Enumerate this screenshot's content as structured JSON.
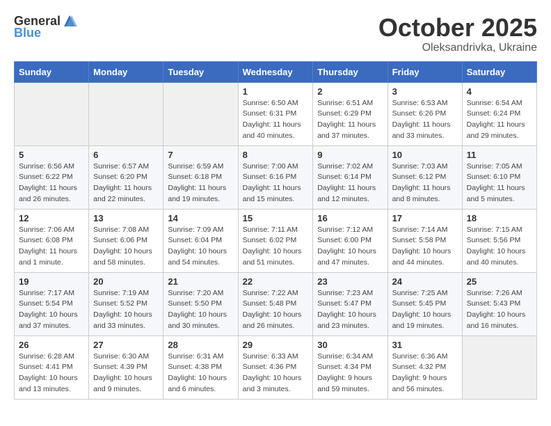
{
  "header": {
    "logo_general": "General",
    "logo_blue": "Blue",
    "title": "October 2025",
    "subtitle": "Oleksandrivka, Ukraine"
  },
  "weekdays": [
    "Sunday",
    "Monday",
    "Tuesday",
    "Wednesday",
    "Thursday",
    "Friday",
    "Saturday"
  ],
  "weeks": [
    [
      {
        "day": "",
        "info": ""
      },
      {
        "day": "",
        "info": ""
      },
      {
        "day": "",
        "info": ""
      },
      {
        "day": "1",
        "info": "Sunrise: 6:50 AM\nSunset: 6:31 PM\nDaylight: 11 hours\nand 40 minutes."
      },
      {
        "day": "2",
        "info": "Sunrise: 6:51 AM\nSunset: 6:29 PM\nDaylight: 11 hours\nand 37 minutes."
      },
      {
        "day": "3",
        "info": "Sunrise: 6:53 AM\nSunset: 6:26 PM\nDaylight: 11 hours\nand 33 minutes."
      },
      {
        "day": "4",
        "info": "Sunrise: 6:54 AM\nSunset: 6:24 PM\nDaylight: 11 hours\nand 29 minutes."
      }
    ],
    [
      {
        "day": "5",
        "info": "Sunrise: 6:56 AM\nSunset: 6:22 PM\nDaylight: 11 hours\nand 26 minutes."
      },
      {
        "day": "6",
        "info": "Sunrise: 6:57 AM\nSunset: 6:20 PM\nDaylight: 11 hours\nand 22 minutes."
      },
      {
        "day": "7",
        "info": "Sunrise: 6:59 AM\nSunset: 6:18 PM\nDaylight: 11 hours\nand 19 minutes."
      },
      {
        "day": "8",
        "info": "Sunrise: 7:00 AM\nSunset: 6:16 PM\nDaylight: 11 hours\nand 15 minutes."
      },
      {
        "day": "9",
        "info": "Sunrise: 7:02 AM\nSunset: 6:14 PM\nDaylight: 11 hours\nand 12 minutes."
      },
      {
        "day": "10",
        "info": "Sunrise: 7:03 AM\nSunset: 6:12 PM\nDaylight: 11 hours\nand 8 minutes."
      },
      {
        "day": "11",
        "info": "Sunrise: 7:05 AM\nSunset: 6:10 PM\nDaylight: 11 hours\nand 5 minutes."
      }
    ],
    [
      {
        "day": "12",
        "info": "Sunrise: 7:06 AM\nSunset: 6:08 PM\nDaylight: 11 hours\nand 1 minute."
      },
      {
        "day": "13",
        "info": "Sunrise: 7:08 AM\nSunset: 6:06 PM\nDaylight: 10 hours\nand 58 minutes."
      },
      {
        "day": "14",
        "info": "Sunrise: 7:09 AM\nSunset: 6:04 PM\nDaylight: 10 hours\nand 54 minutes."
      },
      {
        "day": "15",
        "info": "Sunrise: 7:11 AM\nSunset: 6:02 PM\nDaylight: 10 hours\nand 51 minutes."
      },
      {
        "day": "16",
        "info": "Sunrise: 7:12 AM\nSunset: 6:00 PM\nDaylight: 10 hours\nand 47 minutes."
      },
      {
        "day": "17",
        "info": "Sunrise: 7:14 AM\nSunset: 5:58 PM\nDaylight: 10 hours\nand 44 minutes."
      },
      {
        "day": "18",
        "info": "Sunrise: 7:15 AM\nSunset: 5:56 PM\nDaylight: 10 hours\nand 40 minutes."
      }
    ],
    [
      {
        "day": "19",
        "info": "Sunrise: 7:17 AM\nSunset: 5:54 PM\nDaylight: 10 hours\nand 37 minutes."
      },
      {
        "day": "20",
        "info": "Sunrise: 7:19 AM\nSunset: 5:52 PM\nDaylight: 10 hours\nand 33 minutes."
      },
      {
        "day": "21",
        "info": "Sunrise: 7:20 AM\nSunset: 5:50 PM\nDaylight: 10 hours\nand 30 minutes."
      },
      {
        "day": "22",
        "info": "Sunrise: 7:22 AM\nSunset: 5:48 PM\nDaylight: 10 hours\nand 26 minutes."
      },
      {
        "day": "23",
        "info": "Sunrise: 7:23 AM\nSunset: 5:47 PM\nDaylight: 10 hours\nand 23 minutes."
      },
      {
        "day": "24",
        "info": "Sunrise: 7:25 AM\nSunset: 5:45 PM\nDaylight: 10 hours\nand 19 minutes."
      },
      {
        "day": "25",
        "info": "Sunrise: 7:26 AM\nSunset: 5:43 PM\nDaylight: 10 hours\nand 16 minutes."
      }
    ],
    [
      {
        "day": "26",
        "info": "Sunrise: 6:28 AM\nSunset: 4:41 PM\nDaylight: 10 hours\nand 13 minutes."
      },
      {
        "day": "27",
        "info": "Sunrise: 6:30 AM\nSunset: 4:39 PM\nDaylight: 10 hours\nand 9 minutes."
      },
      {
        "day": "28",
        "info": "Sunrise: 6:31 AM\nSunset: 4:38 PM\nDaylight: 10 hours\nand 6 minutes."
      },
      {
        "day": "29",
        "info": "Sunrise: 6:33 AM\nSunset: 4:36 PM\nDaylight: 10 hours\nand 3 minutes."
      },
      {
        "day": "30",
        "info": "Sunrise: 6:34 AM\nSunset: 4:34 PM\nDaylight: 9 hours\nand 59 minutes."
      },
      {
        "day": "31",
        "info": "Sunrise: 6:36 AM\nSunset: 4:32 PM\nDaylight: 9 hours\nand 56 minutes."
      },
      {
        "day": "",
        "info": ""
      }
    ]
  ]
}
